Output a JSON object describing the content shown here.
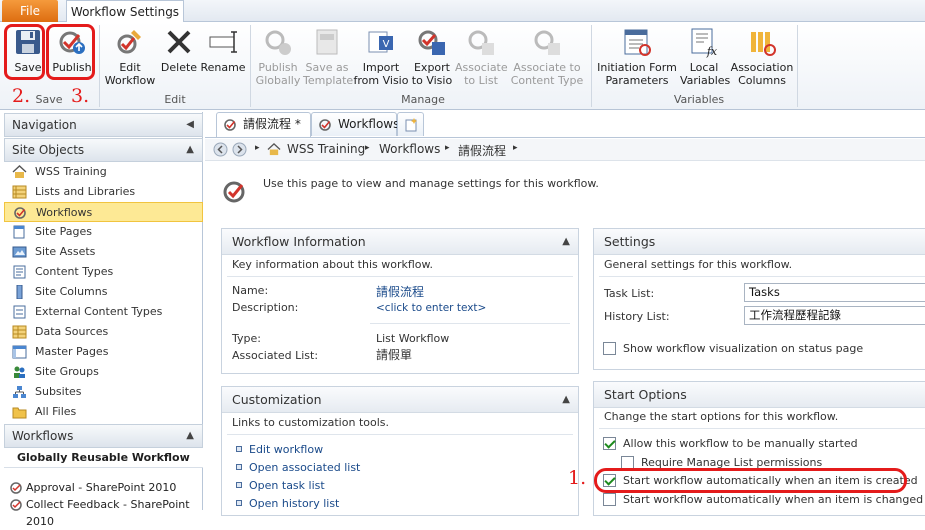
{
  "ribbon": {
    "file_tab": "File",
    "active_tab": "Workflow Settings",
    "buttons": {
      "save": "Save",
      "publish": "Publish",
      "edit_workflow": [
        "Edit",
        "Workflow"
      ],
      "delete": "Delete",
      "rename": "Rename",
      "publish_globally": [
        "Publish",
        "Globally"
      ],
      "save_as_template": [
        "Save as",
        "Template"
      ],
      "import_from_visio": [
        "Import",
        "from Visio"
      ],
      "export_to_visio": [
        "Export",
        "to Visio"
      ],
      "associate_to_list": [
        "Associate",
        "to List"
      ],
      "associate_to_content_type": [
        "Associate to",
        "Content Type"
      ],
      "initiation_form_parameters": [
        "Initiation Form",
        "Parameters"
      ],
      "local_variables": [
        "Local",
        "Variables"
      ],
      "association_columns": [
        "Association",
        "Columns"
      ]
    },
    "groups": {
      "save": "Save",
      "edit": "Edit",
      "manage": "Manage",
      "variables": "Variables"
    }
  },
  "annotations": {
    "one": "1.",
    "two": "2.",
    "three": "3."
  },
  "nav": {
    "header": "Navigation",
    "site_objects_header": "Site Objects",
    "items": [
      {
        "label": "WSS Training",
        "icon": "home-icon"
      },
      {
        "label": "Lists and Libraries",
        "icon": "list-icon"
      },
      {
        "label": "Workflows",
        "icon": "workflow-icon",
        "selected": true
      },
      {
        "label": "Site Pages",
        "icon": "page-icon"
      },
      {
        "label": "Site Assets",
        "icon": "assets-icon"
      },
      {
        "label": "Content Types",
        "icon": "content-type-icon"
      },
      {
        "label": "Site Columns",
        "icon": "column-icon"
      },
      {
        "label": "External Content Types",
        "icon": "external-content-icon"
      },
      {
        "label": "Data Sources",
        "icon": "data-source-icon"
      },
      {
        "label": "Master Pages",
        "icon": "master-page-icon"
      },
      {
        "label": "Site Groups",
        "icon": "group-icon"
      },
      {
        "label": "Subsites",
        "icon": "subsite-icon"
      },
      {
        "label": "All Files",
        "icon": "folder-icon"
      }
    ],
    "workflows_header": "Workflows",
    "workflows_section": "Globally Reusable Workflow",
    "workflow_items": [
      "Approval - SharePoint 2010",
      "Collect Feedback - SharePoint 2010"
    ]
  },
  "doc_tabs": [
    "請假流程 *",
    "Workflows"
  ],
  "breadcrumb": [
    "WSS Training",
    "Workflows",
    "請假流程"
  ],
  "page": {
    "intro": "Use this page to view and manage settings for this workflow."
  },
  "workflow_info": {
    "title": "Workflow Information",
    "desc": "Key information about this workflow.",
    "name_label": "Name:",
    "name_value": "請假流程",
    "description_label": "Description:",
    "description_value": "<click to enter text>",
    "type_label": "Type:",
    "type_value": "List Workflow",
    "assoc_label": "Associated List:",
    "assoc_value": "請假單"
  },
  "customization": {
    "title": "Customization",
    "desc": "Links to customization tools.",
    "links": [
      "Edit workflow",
      "Open associated list",
      "Open task list",
      "Open history list"
    ]
  },
  "settings": {
    "title": "Settings",
    "desc": "General settings for this workflow.",
    "task_list_label": "Task List:",
    "task_list_value": "Tasks",
    "history_list_label": "History List:",
    "history_list_value": "工作流程歷程記錄",
    "visualization_label": "Show workflow visualization on status page"
  },
  "start_options": {
    "title": "Start Options",
    "desc": "Change the start options for this workflow.",
    "manual": "Allow this workflow to be manually started",
    "manual_checked": true,
    "require_manage": "Require Manage List permissions",
    "require_manage_checked": false,
    "on_create": "Start workflow automatically when an item is created",
    "on_create_checked": true,
    "on_change": "Start workflow automatically when an item is changed",
    "on_change_checked": false
  },
  "colors": {
    "annotation_red": "#e41b1b",
    "link_blue": "#1a4a8a",
    "selected_nav": "#fde995"
  }
}
